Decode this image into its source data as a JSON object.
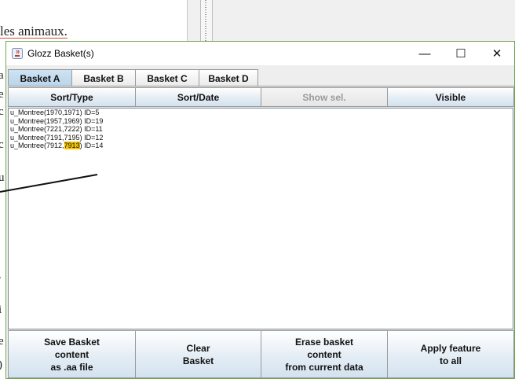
{
  "background_doc": {
    "heading_fragment": "les animaux.",
    "margin_chars": [
      "a",
      "e",
      "c",
      "c",
      "u",
      ".",
      "i",
      "e",
      ")"
    ]
  },
  "window": {
    "title": "Glozz Basket(s)",
    "controls": {
      "minimize": "—",
      "maximize": "☐",
      "close": "✕"
    }
  },
  "tabs": [
    "Basket A",
    "Basket B",
    "Basket C",
    "Basket D"
  ],
  "active_tab": "Basket A",
  "sort_buttons": {
    "sort_type": "Sort/Type",
    "sort_date": "Sort/Date",
    "show_sel": "Show sel.",
    "visible": "Visible"
  },
  "list": {
    "items": [
      {
        "prefix": "u_Montree(1970,1971) ID=5",
        "highlight": "",
        "suffix": ""
      },
      {
        "prefix": "u_Montree(1957,1969) ID=19",
        "highlight": "",
        "suffix": ""
      },
      {
        "prefix": "u_Montree(7221,7222) ID=11",
        "highlight": "",
        "suffix": ""
      },
      {
        "prefix": "u_Montree(7191,7195) ID=12",
        "highlight": "",
        "suffix": ""
      },
      {
        "prefix": "u_Montree(7912,",
        "highlight": "7913",
        "suffix": ") ID=14"
      }
    ],
    "highlight_color": "#f5c400"
  },
  "bottom_buttons": {
    "save": "Save Basket\ncontent\nas .aa file",
    "clear": "Clear\nBasket",
    "erase": "Erase basket\ncontent\nfrom current data",
    "apply": "Apply feature\nto all"
  },
  "colors": {
    "window_border": "#6aa84f",
    "active_tab": "#b8d4ea"
  }
}
